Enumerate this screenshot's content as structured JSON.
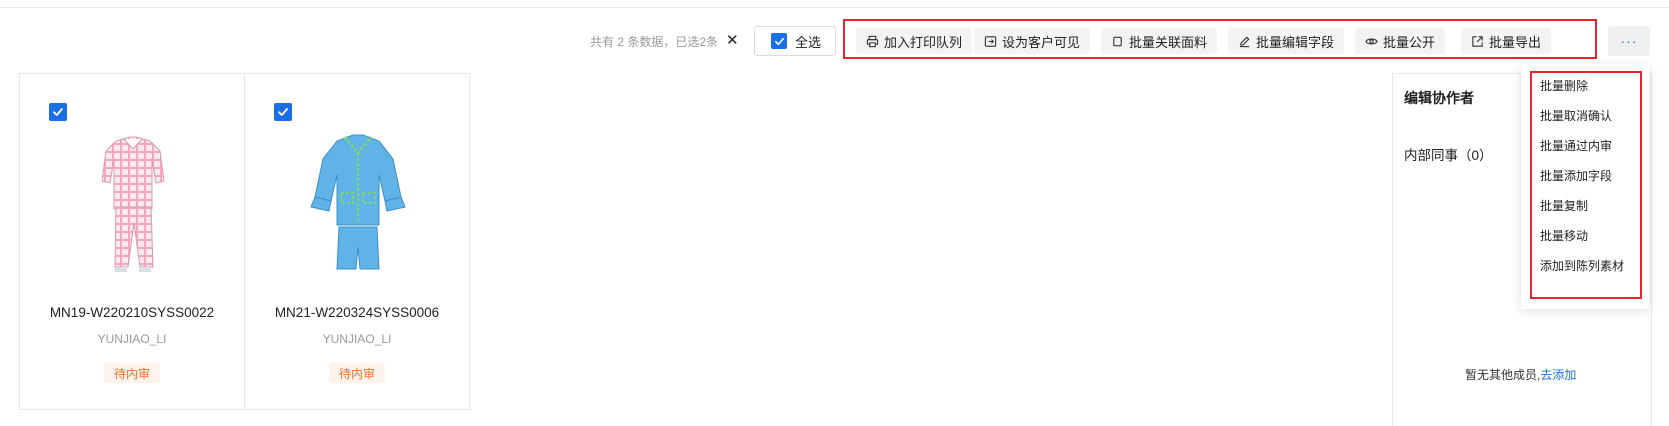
{
  "selection": {
    "summary": "共有 2 条数据，已选2条",
    "clear_label": "✕",
    "select_all_label": "全选",
    "select_all_checked": true
  },
  "toolbar": {
    "buttons": [
      {
        "label": "加入打印队列",
        "icon": "printer-icon"
      },
      {
        "label": "设为客户可见",
        "icon": "share-icon"
      },
      {
        "label": "批量关联面料",
        "icon": "square-icon"
      },
      {
        "label": "批量编辑字段",
        "icon": "pencil-icon"
      },
      {
        "label": "批量公开",
        "icon": "eye-icon"
      },
      {
        "label": "批量导出",
        "icon": "export-icon"
      }
    ],
    "more_label": "···"
  },
  "more_menu": {
    "items": [
      "批量删除",
      "批量取消确认",
      "批量通过内审",
      "批量添加字段",
      "批量复制",
      "批量移动",
      "添加到陈列素材"
    ]
  },
  "cards": [
    {
      "code": "MN19-W220210SYSS0022",
      "owner": "YUNJIAO_LI",
      "status": "待内审",
      "checked": true,
      "image": "pink-plaid-pajama-set"
    },
    {
      "code": "MN21-W220324SYSS0006",
      "owner": "YUNJIAO_LI",
      "status": "待内审",
      "checked": true,
      "image": "blue-short-pajama-set"
    }
  ],
  "collaborators": {
    "title": "编辑协作者",
    "internal_label": "内部同事（0）",
    "empty_text": "暂无其他成员,",
    "add_link": "去添加"
  },
  "colors": {
    "accent": "#1a6fe8",
    "highlight_frame": "#e8242d",
    "status_text": "#f07028",
    "status_bg": "#fff3eb"
  }
}
